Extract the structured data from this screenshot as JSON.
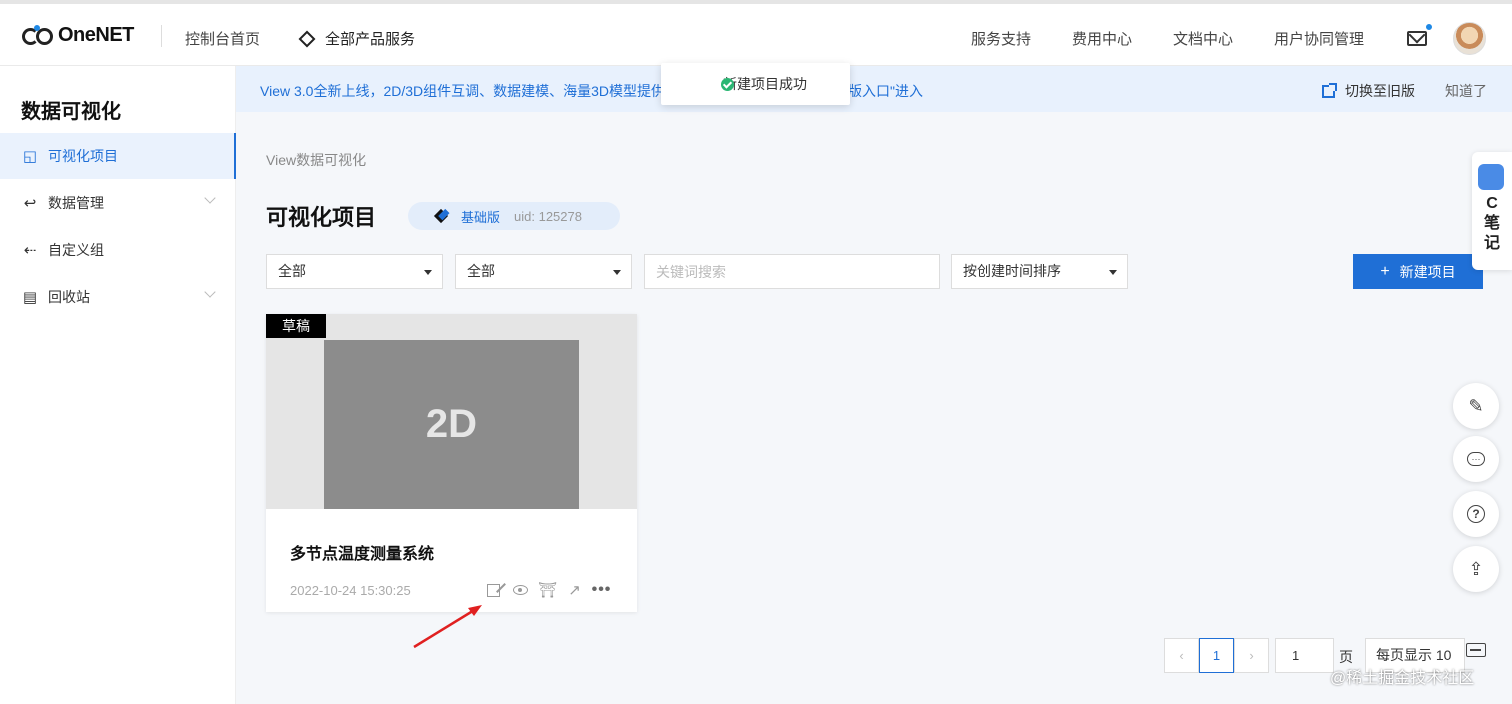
{
  "header": {
    "logo_text": "OneNET",
    "home": "控制台首页",
    "all_products": "全部产品服务",
    "nav": [
      "服务支持",
      "费用中心",
      "文档中心",
      "用户协同管理"
    ]
  },
  "sidebar": {
    "title": "数据可视化",
    "items": [
      {
        "label": "可视化项目",
        "icon": "dashboard-icon"
      },
      {
        "label": "数据管理",
        "icon": "return-icon"
      },
      {
        "label": "自定义组",
        "icon": "link-icon"
      },
      {
        "label": "回收站",
        "icon": "document-icon"
      }
    ]
  },
  "banner": {
    "text_left": "View 3.0全新上线，2D/3D组件互调、数据建模、海量3D模型提供",
    "text_right": "版入口\"进入",
    "switch_old": "切换至旧版",
    "dismiss": "知道了"
  },
  "toast": {
    "message": "新建项目成功"
  },
  "main": {
    "breadcrumb": "View数据可视化",
    "title": "可视化项目",
    "edition": "基础版",
    "uid": "uid: 125278",
    "filter1": "全部",
    "filter2": "全部",
    "search_placeholder": "关键词搜索",
    "sort": "按创建时间排序",
    "new_button": "新建项目"
  },
  "card": {
    "badge": "草稿",
    "thumb_label": "2D",
    "title": "多节点温度测量系统",
    "date": "2022-10-24 15:30:25"
  },
  "note_tab": {
    "letter": "C",
    "text1": "笔",
    "text2": "记"
  },
  "pagination": {
    "prev": "‹",
    "current": "1",
    "next": "›",
    "jump_value": "1",
    "unit": "页",
    "page_size": "每页显示 10"
  },
  "watermark": "@稀土掘金技术社区",
  "colors": {
    "primary": "#1f6fd6",
    "banner_bg": "#e8f1fd",
    "success": "#2bb673"
  }
}
